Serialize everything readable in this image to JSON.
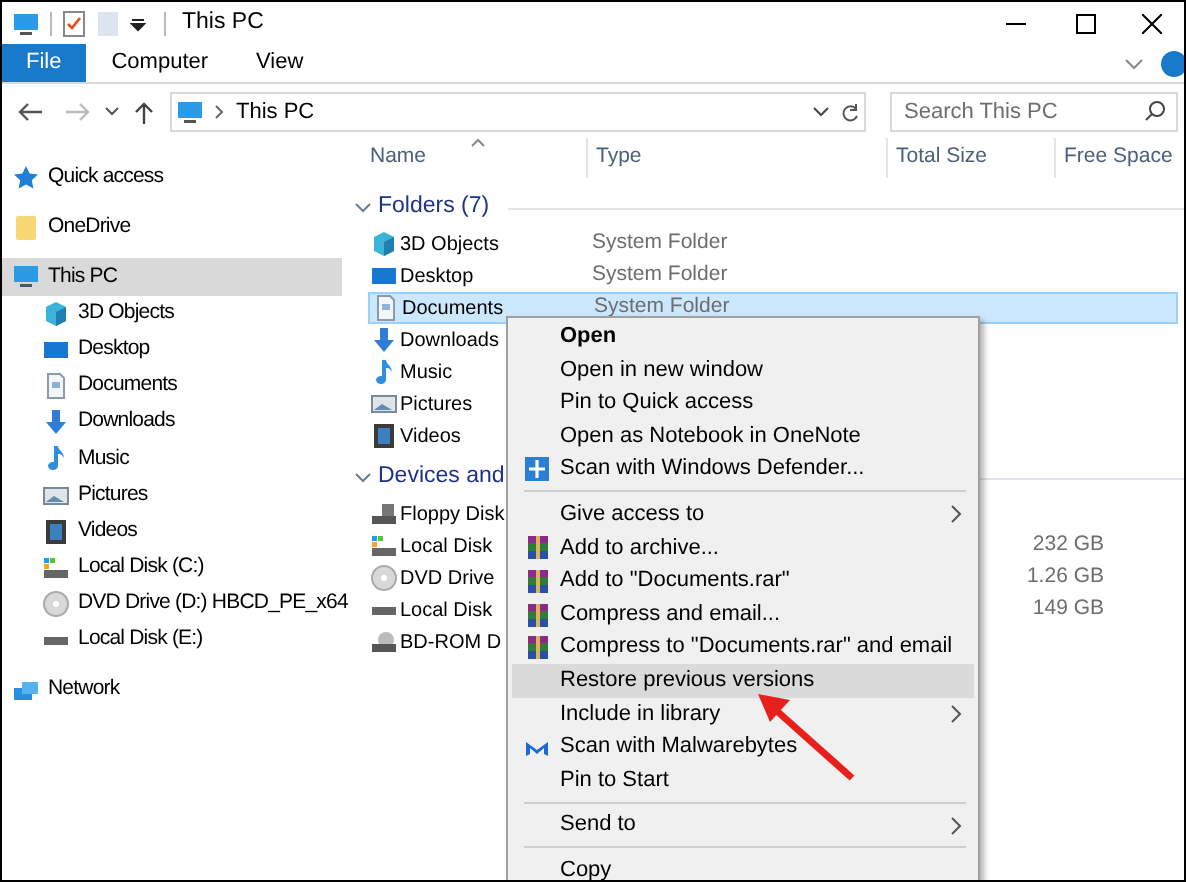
{
  "title_bar": {
    "title": "This PC"
  },
  "ribbon": {
    "tabs": [
      {
        "label": "File",
        "kind": "file"
      },
      {
        "label": "Computer",
        "kind": "tab"
      },
      {
        "label": "View",
        "kind": "tab"
      }
    ]
  },
  "address_bar": {
    "path": "This PC"
  },
  "search": {
    "placeholder": "Search This PC"
  },
  "sidebar": {
    "items": [
      {
        "label": "Quick access",
        "kind": "star",
        "selected": false
      },
      {
        "label": "OneDrive",
        "kind": "folder",
        "selected": false
      },
      {
        "label": "This PC",
        "kind": "pc",
        "selected": true,
        "children": [
          {
            "label": "3D Objects",
            "kind": "cube",
            "selected": false
          },
          {
            "label": "Desktop",
            "kind": "desktop",
            "selected": false
          },
          {
            "label": "Documents",
            "kind": "doc",
            "selected": false
          },
          {
            "label": "Downloads",
            "kind": "download",
            "selected": false
          },
          {
            "label": "Music",
            "kind": "music",
            "selected": false
          },
          {
            "label": "Pictures",
            "kind": "pictures",
            "selected": false
          },
          {
            "label": "Videos",
            "kind": "videos",
            "selected": false
          },
          {
            "label": "Local Disk (C:)",
            "kind": "disk-c",
            "selected": false
          },
          {
            "label": "DVD Drive (D:) HBCD_PE_x64",
            "kind": "dvd",
            "selected": false
          },
          {
            "label": "Local Disk (E:)",
            "kind": "disk",
            "selected": false
          }
        ]
      },
      {
        "label": "Network",
        "kind": "network",
        "selected": false
      }
    ]
  },
  "columns": [
    "Name",
    "Type",
    "Total Size",
    "Free Space"
  ],
  "groups": [
    {
      "title": "Folders (7)",
      "items": [
        {
          "name": "3D Objects",
          "type": "System Folder",
          "kind": "cube",
          "selected": false
        },
        {
          "name": "Desktop",
          "type": "System Folder",
          "kind": "desktop",
          "selected": false
        },
        {
          "name": "Documents",
          "type": "System Folder",
          "kind": "doc",
          "selected": true
        },
        {
          "name": "Downloads",
          "kind": "download",
          "selected": false
        },
        {
          "name": "Music",
          "kind": "music",
          "selected": false
        },
        {
          "name": "Pictures",
          "kind": "pictures",
          "selected": false
        },
        {
          "name": "Videos",
          "kind": "videos",
          "selected": false
        }
      ]
    },
    {
      "title": "Devices and",
      "items": [
        {
          "name": "Floppy Disk",
          "kind": "floppy",
          "selected": false
        },
        {
          "name": "Local Disk",
          "kind": "disk-c",
          "total_size": "232 GB",
          "selected": false
        },
        {
          "name": "DVD Drive",
          "kind": "dvd",
          "total_size": "1.26 GB",
          "selected": false
        },
        {
          "name": "Local Disk",
          "kind": "disk",
          "total_size": "149 GB",
          "selected": false
        },
        {
          "name": "BD-ROM D",
          "kind": "bdrom",
          "selected": false
        }
      ]
    }
  ],
  "context_menu": {
    "items": [
      {
        "kind": "plain",
        "label": "Open",
        "bold": true,
        "submenu": false,
        "selected": false
      },
      {
        "kind": "plain",
        "label": "Open in new window",
        "bold": false,
        "submenu": false,
        "selected": false
      },
      {
        "kind": "plain",
        "label": "Pin to Quick access",
        "bold": false,
        "submenu": false,
        "selected": false
      },
      {
        "kind": "plain",
        "label": "Open as Notebook in OneNote",
        "bold": false,
        "submenu": false,
        "selected": false
      },
      {
        "kind": "defender",
        "label": "Scan with Windows Defender...",
        "bold": false,
        "submenu": false,
        "selected": false
      },
      {
        "kind": "separator"
      },
      {
        "kind": "plain",
        "label": "Give access to",
        "bold": false,
        "submenu": true,
        "selected": false
      },
      {
        "kind": "archive",
        "label": "Add to archive...",
        "bold": false,
        "submenu": false,
        "selected": false
      },
      {
        "kind": "archive",
        "label": "Add to \"Documents.rar\"",
        "bold": false,
        "submenu": false,
        "selected": false
      },
      {
        "kind": "archive",
        "label": "Compress and email...",
        "bold": false,
        "submenu": false,
        "selected": false
      },
      {
        "kind": "archive",
        "label": "Compress to \"Documents.rar\" and email",
        "bold": false,
        "submenu": false,
        "selected": false
      },
      {
        "kind": "plain",
        "label": "Restore previous versions",
        "bold": false,
        "submenu": false,
        "selected": true
      },
      {
        "kind": "plain",
        "label": "Include in library",
        "bold": false,
        "submenu": true,
        "selected": false
      },
      {
        "kind": "malware",
        "label": "Scan with Malwarebytes",
        "bold": false,
        "submenu": false,
        "selected": false
      },
      {
        "kind": "plain",
        "label": "Pin to Start",
        "bold": false,
        "submenu": false,
        "selected": false
      },
      {
        "kind": "separator"
      },
      {
        "kind": "plain",
        "label": "Send to",
        "bold": false,
        "submenu": true,
        "selected": false
      },
      {
        "kind": "separator"
      },
      {
        "kind": "plain",
        "label": "Copy",
        "bold": false,
        "submenu": false,
        "selected": false
      }
    ]
  }
}
